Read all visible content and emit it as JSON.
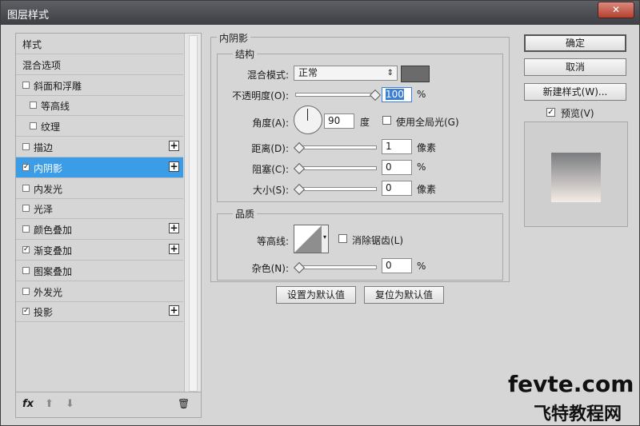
{
  "window": {
    "title": "图层样式",
    "close": "✕"
  },
  "left": {
    "items": [
      {
        "label": "样式",
        "checkbox": false,
        "checked": false,
        "plus": false,
        "indent": 0
      },
      {
        "label": "混合选项",
        "checkbox": false,
        "checked": false,
        "plus": false,
        "indent": 0
      },
      {
        "label": "斜面和浮雕",
        "checkbox": true,
        "checked": false,
        "plus": false,
        "indent": 0
      },
      {
        "label": "等高线",
        "checkbox": true,
        "checked": false,
        "plus": false,
        "indent": 1
      },
      {
        "label": "纹理",
        "checkbox": true,
        "checked": false,
        "plus": false,
        "indent": 1
      },
      {
        "label": "描边",
        "checkbox": true,
        "checked": false,
        "plus": true,
        "indent": 0
      },
      {
        "label": "内阴影",
        "checkbox": true,
        "checked": true,
        "plus": true,
        "indent": 0,
        "selected": true
      },
      {
        "label": "内发光",
        "checkbox": true,
        "checked": false,
        "plus": false,
        "indent": 0
      },
      {
        "label": "光泽",
        "checkbox": true,
        "checked": false,
        "plus": false,
        "indent": 0
      },
      {
        "label": "颜色叠加",
        "checkbox": true,
        "checked": false,
        "plus": true,
        "indent": 0
      },
      {
        "label": "渐变叠加",
        "checkbox": true,
        "checked": true,
        "plus": true,
        "indent": 0
      },
      {
        "label": "图案叠加",
        "checkbox": true,
        "checked": false,
        "plus": false,
        "indent": 0
      },
      {
        "label": "外发光",
        "checkbox": true,
        "checked": false,
        "plus": false,
        "indent": 0
      },
      {
        "label": "投影",
        "checkbox": true,
        "checked": true,
        "plus": true,
        "indent": 0
      }
    ],
    "bottom": {
      "fx": "fx",
      "up": "⬆",
      "down": "⬇",
      "trash": "🗑"
    }
  },
  "section": {
    "title": "内阴影",
    "structure": {
      "title": "结构",
      "blend_label": "混合模式:",
      "blend_value": "正常",
      "opacity_label": "不透明度(O):",
      "opacity_value": "100",
      "opacity_unit": "%",
      "angle_label": "角度(A):",
      "angle_value": "90",
      "angle_unit": "度",
      "global_light_label": "使用全局光(G)",
      "distance_label": "距离(D):",
      "distance_value": "1",
      "distance_unit": "像素",
      "choke_label": "阻塞(C):",
      "choke_value": "0",
      "choke_unit": "%",
      "size_label": "大小(S):",
      "size_value": "0",
      "size_unit": "像素"
    },
    "quality": {
      "title": "品质",
      "contour_label": "等高线:",
      "antialias_label": "消除锯齿(L)",
      "noise_label": "杂色(N):",
      "noise_value": "0",
      "noise_unit": "%"
    },
    "set_default": "设置为默认值",
    "reset_default": "复位为默认值"
  },
  "right": {
    "ok": "确定",
    "cancel": "取消",
    "new_style": "新建样式(W)...",
    "preview_label": "预览(V)",
    "preview_checked": true
  },
  "watermark": {
    "line1": "fevte.com",
    "line2": "飞特教程网"
  },
  "colors": {
    "selected": "#3b9de8",
    "shadow_swatch": "#6b6b6b"
  }
}
